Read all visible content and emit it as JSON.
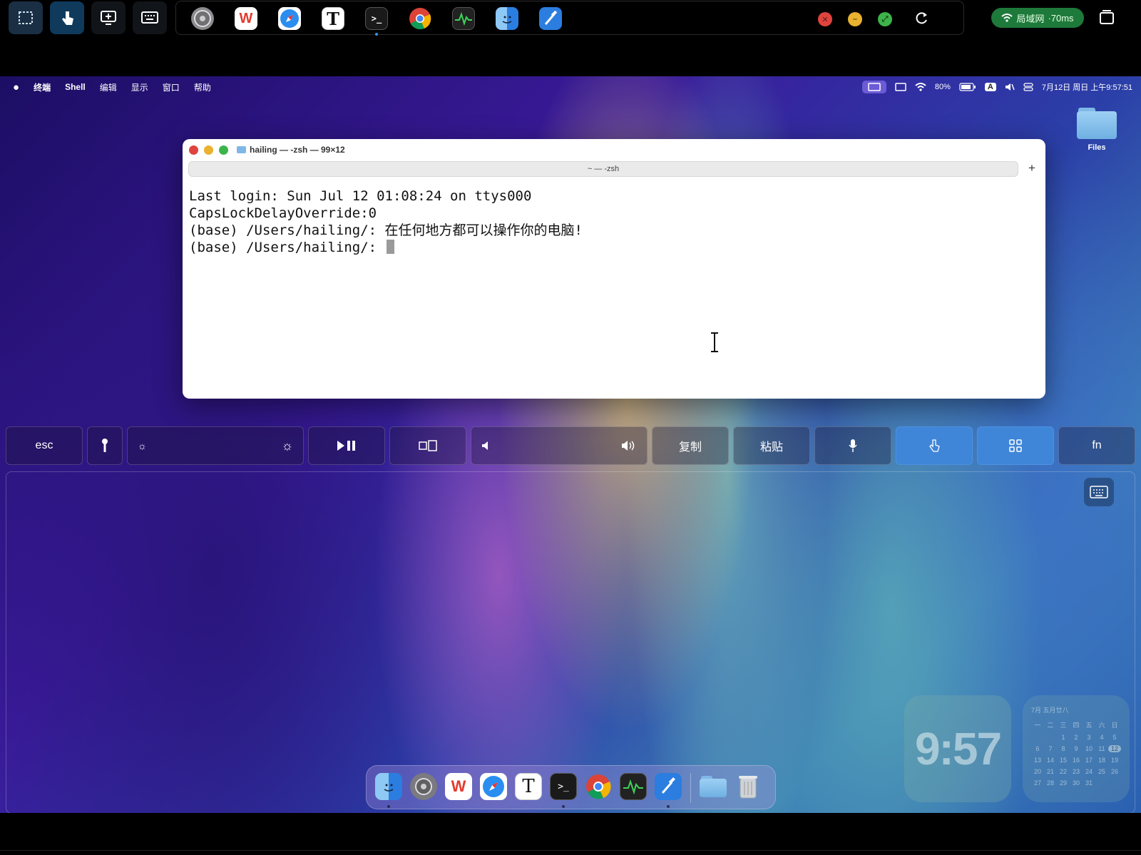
{
  "remote_toolbar": {
    "tools": [
      "select-region-tool",
      "touch-pointer-tool",
      "screen-add-tool",
      "keyboard-tool"
    ],
    "apps": [
      "System Settings",
      "WPS Office",
      "Safari",
      "Typora",
      "Terminal",
      "Chrome",
      "Activity Monitor",
      "Finder",
      "Xcode"
    ],
    "network_label": "局域网",
    "latency": "·70ms"
  },
  "menubar": {
    "app_name": "终端",
    "items": [
      "Shell",
      "编辑",
      "显示",
      "窗口",
      "帮助"
    ],
    "battery": "80%",
    "input_method": "A",
    "datetime": "7月12日 周日 上午9:57:51"
  },
  "desktop": {
    "files_label": "Files"
  },
  "terminal": {
    "title": "hailing — -zsh — 99×12",
    "tab_label": "~ — -zsh",
    "lines": [
      "Last login: Sun Jul 12 01:08:24 on ttys000",
      "CapsLockDelayOverride:0",
      "(base) /Users/hailing/: 在任何地方都可以操作你的电脑!",
      "(base) /Users/hailing/: "
    ]
  },
  "touchbar": {
    "esc": "esc",
    "copy": "复制",
    "paste": "粘贴",
    "fn": "fn"
  },
  "widgets": {
    "clock": "9:57",
    "calendar": {
      "header": "7月 五月廿八",
      "weekdays": [
        "一",
        "二",
        "三",
        "四",
        "五",
        "六",
        "日"
      ],
      "days": [
        "",
        "",
        "1",
        "2",
        "3",
        "4",
        "5",
        "6",
        "7",
        "8",
        "9",
        "10",
        "11",
        "12",
        "13",
        "14",
        "15",
        "16",
        "17",
        "18",
        "19",
        "20",
        "21",
        "22",
        "23",
        "24",
        "25",
        "26",
        "27",
        "28",
        "29",
        "30",
        "31",
        "",
        ""
      ],
      "today": "12"
    }
  },
  "dock": {
    "apps": [
      "Finder",
      "System Settings",
      "WPS Office",
      "Safari",
      "Typora",
      "Terminal",
      "Chrome",
      "Activity Monitor",
      "Xcode",
      "Downloads",
      "Trash"
    ]
  },
  "colors": {
    "accent_blue": "#3f86d9",
    "net_green": "#1e7a3a",
    "close_red": "#e0443e",
    "minimize_yellow": "#e9b22f",
    "zoom_green": "#3db44a"
  }
}
